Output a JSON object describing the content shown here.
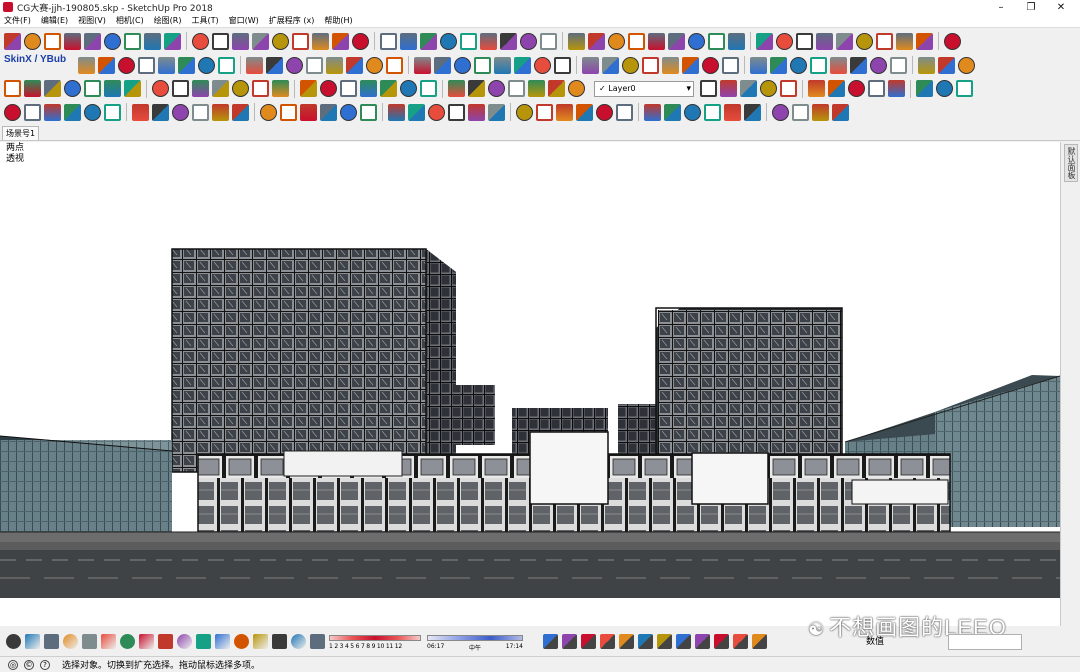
{
  "window": {
    "title": "CG大赛-jjh-190805.skp - SketchUp Pro 2018",
    "minimize_glyph": "–",
    "maximize_glyph": "❐",
    "close_glyph": "✕"
  },
  "menu": [
    "文件(F)",
    "编辑(E)",
    "视图(V)",
    "相机(C)",
    "绘图(R)",
    "工具(T)",
    "窗口(W)",
    "扩展程序 (x)",
    "帮助(H)"
  ],
  "toolbar": {
    "skinx_label": "SkinX / YBub",
    "layer_value": "✓  Layer0"
  },
  "scenes": {
    "tab_label": "场景号1"
  },
  "viewport": {
    "label_line1": "两点",
    "label_line2": "透视"
  },
  "sidebar": {
    "tab_label": "默认面板"
  },
  "shadow_bar": {
    "numbers": "1 2 3 4 5 6 7 8 9 10 11 12"
  },
  "time_bar": {
    "start": "06:17",
    "middle": "中午",
    "end": "17:14"
  },
  "vcb": {
    "label": "数值"
  },
  "watermark": {
    "text": "不想画图的LEEO"
  },
  "status": {
    "message": "选择对象。切换到扩充选择。拖动鼠标选择多项。"
  },
  "colors": {
    "accent_red": "#c8102e",
    "tool_blue": "#2f6fd1",
    "toolbar_bg": "#f0f0f0",
    "viewport_bg": "#ffffff"
  }
}
